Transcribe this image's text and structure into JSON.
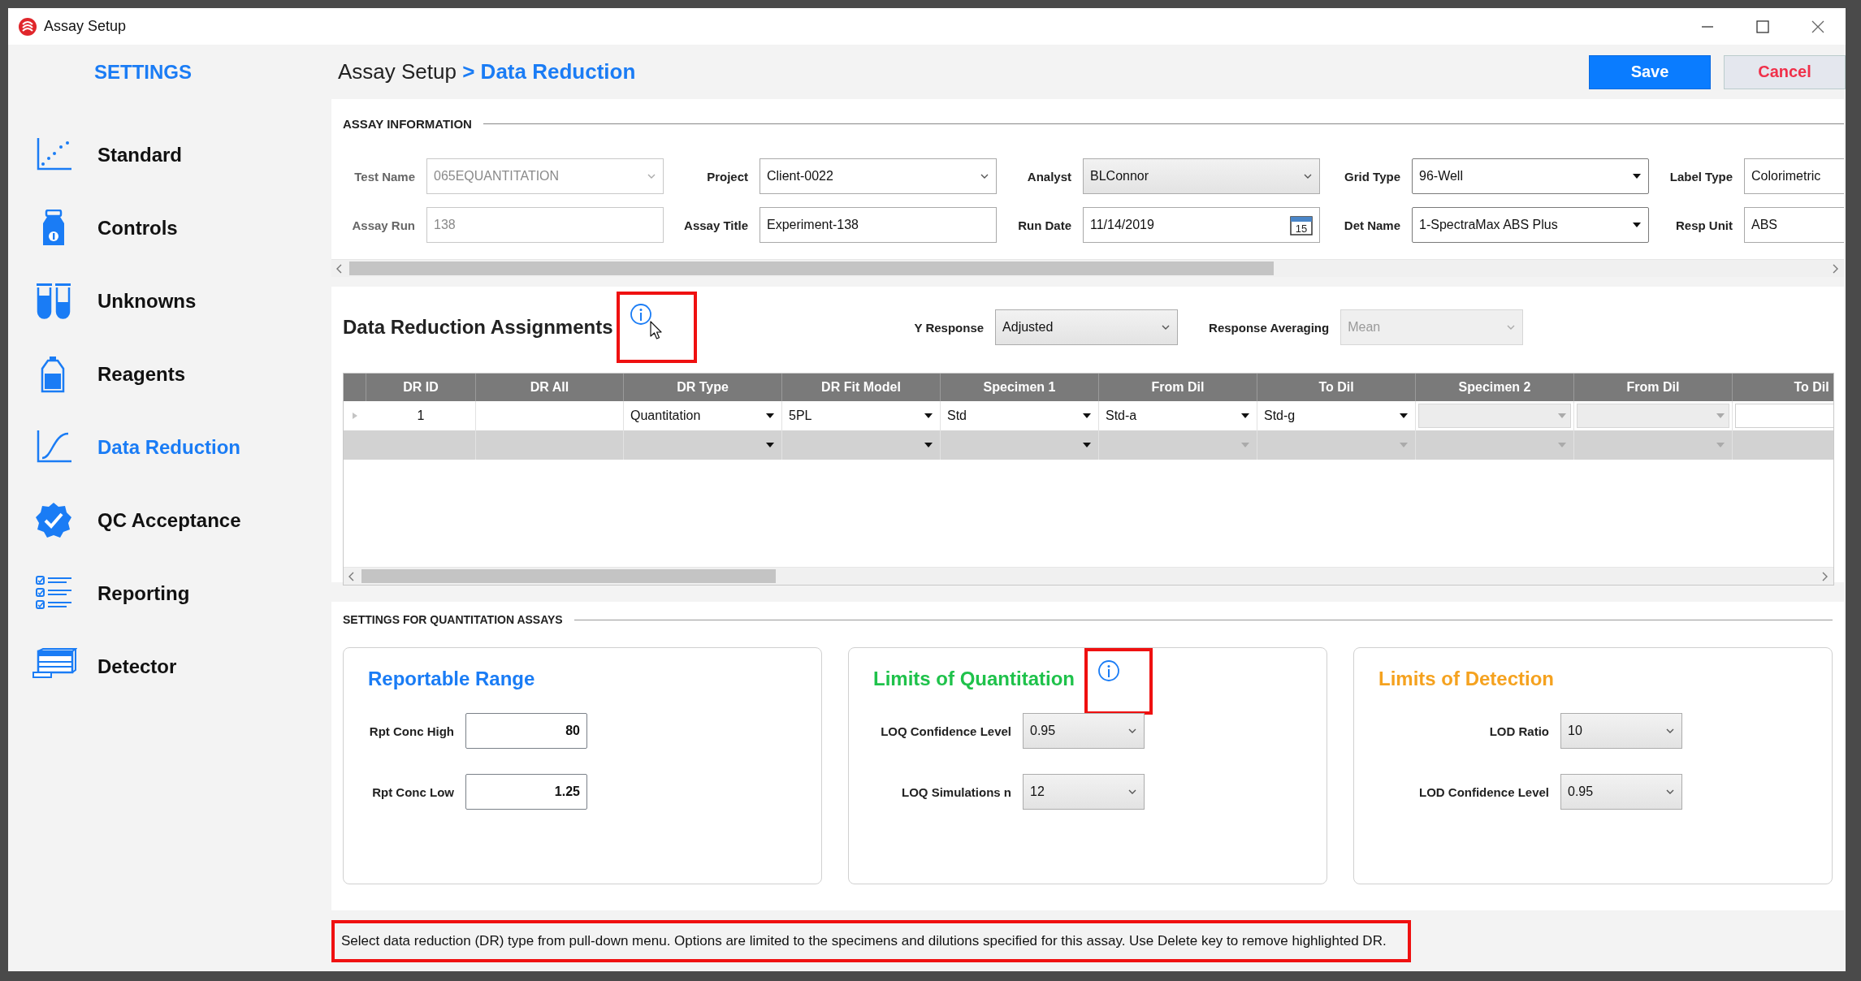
{
  "window": {
    "title": "Assay Setup"
  },
  "sidebar": {
    "heading": "SETTINGS",
    "items": [
      {
        "label": "Standard",
        "kind": "scatter",
        "selected": false
      },
      {
        "label": "Controls",
        "kind": "vial",
        "selected": false
      },
      {
        "label": "Unknowns",
        "kind": "tubes",
        "selected": false
      },
      {
        "label": "Reagents",
        "kind": "bottle",
        "selected": false
      },
      {
        "label": "Data Reduction",
        "kind": "curve",
        "selected": true
      },
      {
        "label": "QC Acceptance",
        "kind": "badge",
        "selected": false
      },
      {
        "label": "Reporting",
        "kind": "checklist",
        "selected": false
      },
      {
        "label": "Detector",
        "kind": "reader",
        "selected": false
      }
    ]
  },
  "header": {
    "breadcrumb_root": "Assay Setup",
    "breadcrumb_current": "> Data Reduction",
    "buttons": [
      {
        "label": "Save",
        "kind": "primary"
      },
      {
        "label": "Cancel",
        "kind": "cancel"
      }
    ]
  },
  "assay_information": {
    "heading": "ASSAY INFORMATION",
    "fields": [
      {
        "label": "Test Name",
        "value": "065EQUANTITATION",
        "kind": "combo",
        "disabled": true
      },
      {
        "label": "Project",
        "value": "Client-0022",
        "kind": "combo",
        "disabled": false
      },
      {
        "label": "Analyst",
        "value": "BLConnor",
        "kind": "shaded",
        "disabled": false
      },
      {
        "label": "Grid Type",
        "value": "96-Well",
        "kind": "select",
        "disabled": false
      },
      {
        "label": "Label Type",
        "value": "Colorimetric",
        "kind": "text",
        "disabled": false
      },
      {
        "label": "Assay Run",
        "value": "138",
        "kind": "text",
        "disabled": true
      },
      {
        "label": "Assay Title",
        "value": "Experiment-138",
        "kind": "text",
        "disabled": false
      },
      {
        "label": "Run Date",
        "value": "11/14/2019",
        "kind": "date",
        "disabled": false,
        "calendar_day": "15"
      },
      {
        "label": "Det Name",
        "value": "1-SpectraMax ABS Plus",
        "kind": "select",
        "disabled": false
      },
      {
        "label": "Resp Unit",
        "value": "ABS",
        "kind": "text",
        "disabled": false
      }
    ]
  },
  "data_reduction": {
    "title": "Data Reduction Assignments",
    "info_highlighted": true,
    "y_response": {
      "label": "Y Response",
      "value": "Adjusted",
      "disabled": false
    },
    "response_averaging": {
      "label": "Response Averaging",
      "value": "Mean",
      "disabled": true
    },
    "table": {
      "columns": [
        "DR ID",
        "DR All",
        "DR Type",
        "DR Fit Model",
        "Specimen 1",
        "From Dil",
        "To Dil",
        "Specimen 2",
        "From Dil",
        "To Dil"
      ],
      "rows": [
        {
          "new_row": false,
          "cells": [
            {
              "kind": "text",
              "value": "1"
            },
            {
              "kind": "blank"
            },
            {
              "kind": "dropdown",
              "value": "Quantitation",
              "enabled": true
            },
            {
              "kind": "dropdown",
              "value": "5PL",
              "enabled": true
            },
            {
              "kind": "dropdown",
              "value": "Std",
              "enabled": true
            },
            {
              "kind": "dropdown",
              "value": "Std-a",
              "enabled": true
            },
            {
              "kind": "dropdown",
              "value": "Std-g",
              "enabled": true
            },
            {
              "kind": "dropdown",
              "enabled": false
            },
            {
              "kind": "dropdown",
              "enabled": false
            },
            {
              "kind": "box"
            }
          ]
        },
        {
          "new_row": true,
          "cells": [
            {
              "kind": "blank"
            },
            {
              "kind": "blank"
            },
            {
              "kind": "dropdown",
              "enabled": true
            },
            {
              "kind": "dropdown",
              "enabled": true
            },
            {
              "kind": "dropdown",
              "enabled": true
            },
            {
              "kind": "dropdown",
              "enabled": false
            },
            {
              "kind": "dropdown",
              "enabled": false
            },
            {
              "kind": "dropdown",
              "enabled": false
            },
            {
              "kind": "dropdown",
              "enabled": false
            },
            {
              "kind": "blank"
            }
          ]
        }
      ]
    }
  },
  "quantitation_settings": {
    "heading": "SETTINGS FOR QUANTITATION ASSAYS",
    "cards": [
      {
        "title": "Reportable Range",
        "color": "#1a7cf5",
        "info_icon": false,
        "fields": [
          {
            "label": "Rpt Conc High",
            "value": "80",
            "kind": "number"
          },
          {
            "label": "Rpt Conc Low",
            "value": "1.25",
            "kind": "number"
          }
        ]
      },
      {
        "title": "Limits of Quantitation",
        "color": "#1fc24b",
        "info_icon": true,
        "info_highlighted": true,
        "fields": [
          {
            "label": "LOQ Confidence Level",
            "value": "0.95",
            "kind": "shaded"
          },
          {
            "label": "LOQ Simulations n",
            "value": "12",
            "kind": "shaded"
          }
        ]
      },
      {
        "title": "Limits of Detection",
        "color": "#f5a21f",
        "info_icon": false,
        "fields": [
          {
            "label": "LOD Ratio",
            "value": "10",
            "kind": "shaded"
          },
          {
            "label": "LOD Confidence Level",
            "value": "0.95",
            "kind": "shaded"
          }
        ]
      }
    ]
  },
  "status_bar": {
    "text": "Select data reduction (DR) type from pull-down menu.  Options are limited to the specimens and dilutions specified for this assay. Use Delete key to remove highlighted DR.",
    "highlighted": true
  }
}
